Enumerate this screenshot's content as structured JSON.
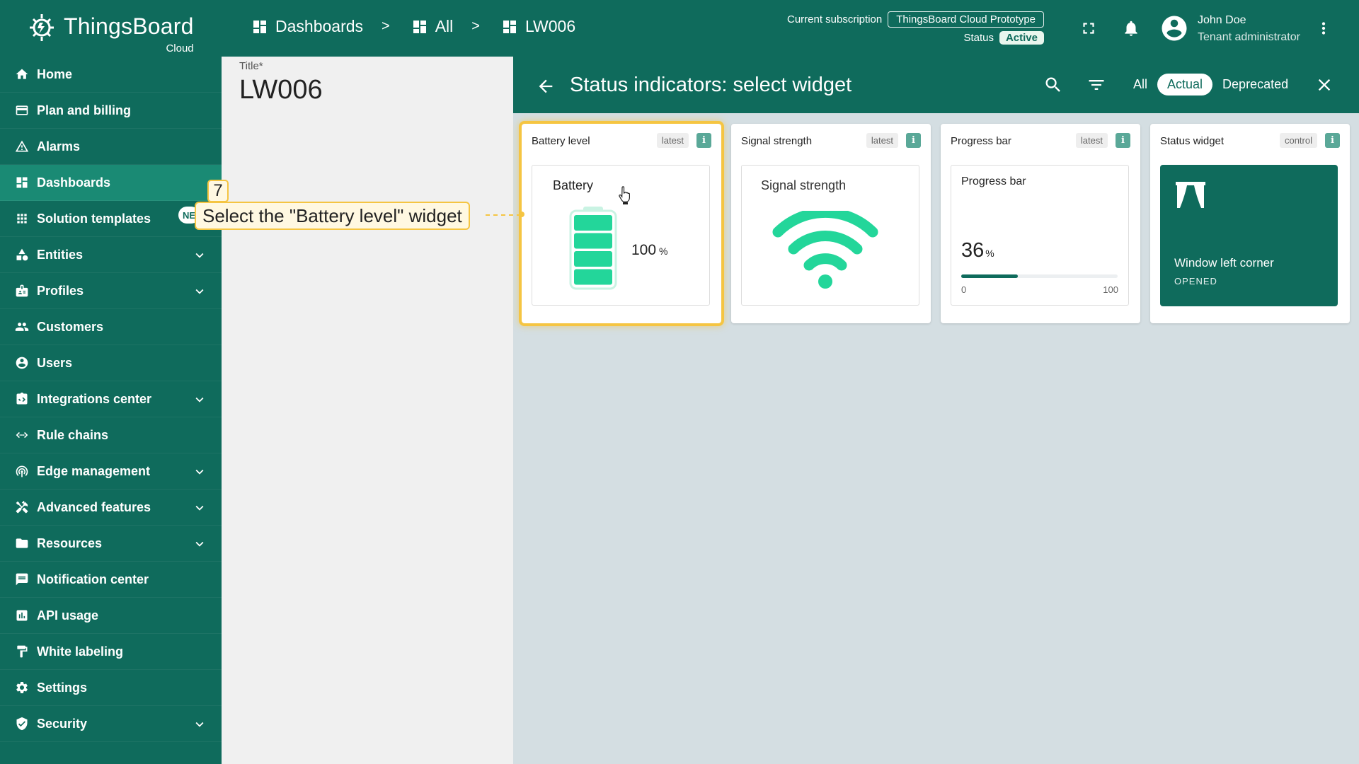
{
  "app": {
    "logo_name": "ThingsBoard",
    "logo_sub": "Cloud"
  },
  "breadcrumb": [
    {
      "label": "Dashboards",
      "icon": "dashboard-icon"
    },
    {
      "label": "All",
      "icon": "dashboard-icon"
    },
    {
      "label": "LW006",
      "icon": "dashboard-icon"
    }
  ],
  "breadcrumb_separator": ">",
  "subscription": {
    "label": "Current subscription",
    "plan": "ThingsBoard Cloud Prototype",
    "status_label": "Status",
    "status": "Active"
  },
  "user": {
    "name": "John Doe",
    "role": "Tenant administrator"
  },
  "sidebar": {
    "items": [
      {
        "label": "Home",
        "icon": "home-icon",
        "expandable": false
      },
      {
        "label": "Plan and billing",
        "icon": "billing-icon",
        "expandable": false
      },
      {
        "label": "Alarms",
        "icon": "alarm-icon",
        "expandable": false
      },
      {
        "label": "Dashboards",
        "icon": "dashboard-icon",
        "expandable": false,
        "active": true
      },
      {
        "label": "Solution templates",
        "icon": "grid-icon",
        "expandable": false
      },
      {
        "label": "Entities",
        "icon": "entities-icon",
        "expandable": true
      },
      {
        "label": "Profiles",
        "icon": "profiles-icon",
        "expandable": true
      },
      {
        "label": "Customers",
        "icon": "customers-icon",
        "expandable": false
      },
      {
        "label": "Users",
        "icon": "user-icon",
        "expandable": false
      },
      {
        "label": "Integrations center",
        "icon": "integrations-icon",
        "expandable": true
      },
      {
        "label": "Rule chains",
        "icon": "rule-chain-icon",
        "expandable": false
      },
      {
        "label": "Edge management",
        "icon": "edge-icon",
        "expandable": true
      },
      {
        "label": "Advanced features",
        "icon": "tools-icon",
        "expandable": true
      },
      {
        "label": "Resources",
        "icon": "folder-icon",
        "expandable": true
      },
      {
        "label": "Notification center",
        "icon": "notification-icon",
        "expandable": false
      },
      {
        "label": "API usage",
        "icon": "api-usage-icon",
        "expandable": false
      },
      {
        "label": "White labeling",
        "icon": "paint-roller-icon",
        "expandable": false
      },
      {
        "label": "Settings",
        "icon": "gear-icon",
        "expandable": false
      },
      {
        "label": "Security",
        "icon": "shield-icon",
        "expandable": true
      }
    ],
    "new_badge": "NE"
  },
  "dashboard": {
    "title_label": "Title*",
    "title_value": "LW006"
  },
  "panel": {
    "title": "Status indicators: select widget",
    "tabs": [
      {
        "label": "All",
        "selected": false
      },
      {
        "label": "Actual",
        "selected": true
      },
      {
        "label": "Deprecated",
        "selected": false
      }
    ]
  },
  "widgets": [
    {
      "name": "Battery level",
      "tag": "latest",
      "info": "i",
      "preview_title": "Battery",
      "value": "100",
      "unit": "%",
      "level": 1.0,
      "color": "#23d69a"
    },
    {
      "name": "Signal strength",
      "tag": "latest",
      "info": "i",
      "preview_title": "Signal strength",
      "color": "#23d69a"
    },
    {
      "name": "Progress bar",
      "tag": "latest",
      "info": "i",
      "preview_title": "Progress bar",
      "value": "36",
      "unit": "%",
      "min": "0",
      "max": "100",
      "fraction": 0.36
    },
    {
      "name": "Status widget",
      "tag": "control",
      "info": "i",
      "preview_title": "Window left corner",
      "preview_sub": "OPENED",
      "icon": "curtains-icon"
    }
  ],
  "tutorial": {
    "step": "7",
    "text": "Select the \"Battery level\" widget"
  },
  "colors": {
    "brand": "#0f6b5c",
    "highlight": "#f5c542",
    "battery_green": "#23d69a"
  }
}
